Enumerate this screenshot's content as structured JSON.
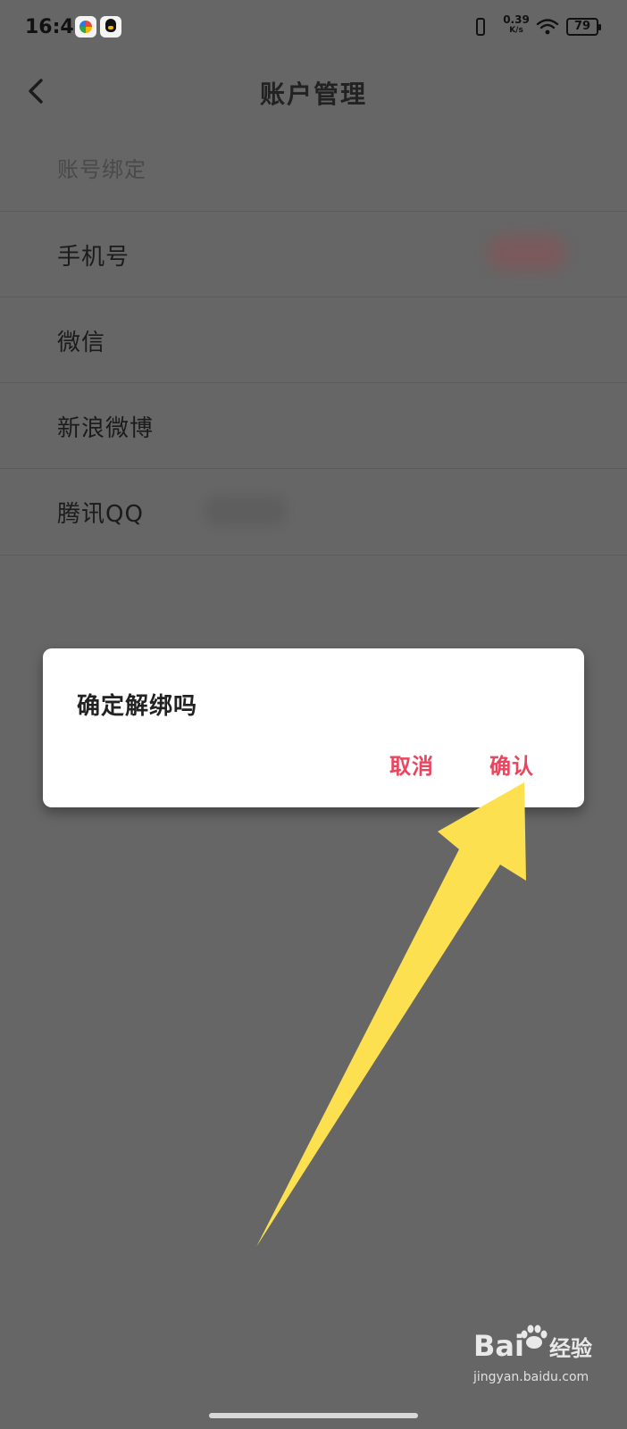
{
  "status_bar": {
    "time": "16:41",
    "network_speed": "0.39",
    "network_speed_unit": "K/s",
    "battery": "79",
    "icons": [
      "app-icon",
      "qq-icon",
      "vibrate-icon",
      "wifi-icon",
      "battery-icon"
    ]
  },
  "header": {
    "title": "账户管理",
    "back_icon": "chevron-left-icon"
  },
  "list": {
    "section_header": "账号绑定",
    "items": [
      {
        "label": "手机号"
      },
      {
        "label": "微信"
      },
      {
        "label": "新浪微博"
      },
      {
        "label": "腾讯QQ"
      }
    ]
  },
  "dialog": {
    "message": "确定解绑吗",
    "cancel_label": "取消",
    "confirm_label": "确认",
    "accent_color": "#e8455e"
  },
  "overlay": {
    "arrow_color": "#fde04f",
    "scrim_color": "#666666"
  },
  "watermark": {
    "logo": "Bai",
    "logo_suffix": "经验",
    "url": "jingyan.baidu.com"
  }
}
